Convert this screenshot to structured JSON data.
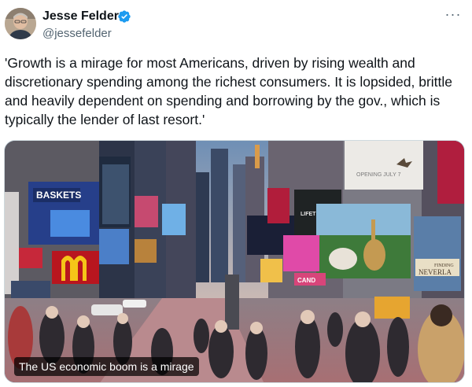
{
  "author": {
    "display_name": "Jesse Felder",
    "handle": "@jessefelder",
    "verified_icon": "verified-badge-icon",
    "verified_color": "#1d9bf0"
  },
  "post": {
    "text": "'Growth is a mirage for most Americans, driven by rising wealth and discretionary spending among the richest consumers. It is lopsided, brittle and heavily dependent on spending and borrowing by the gov., which is typically the lender of last resort.'"
  },
  "menu": {
    "icon": "more-options-icon",
    "glyph": "···"
  },
  "media": {
    "caption": "The US economic boom is a mirage",
    "billboards": {
      "baskets": "BASKETS",
      "lifetime": "LIFETIME",
      "opening": "OPENING JULY 7",
      "finding": "FINDING",
      "neverland": "NEVERLA",
      "candy": "CAND"
    }
  }
}
